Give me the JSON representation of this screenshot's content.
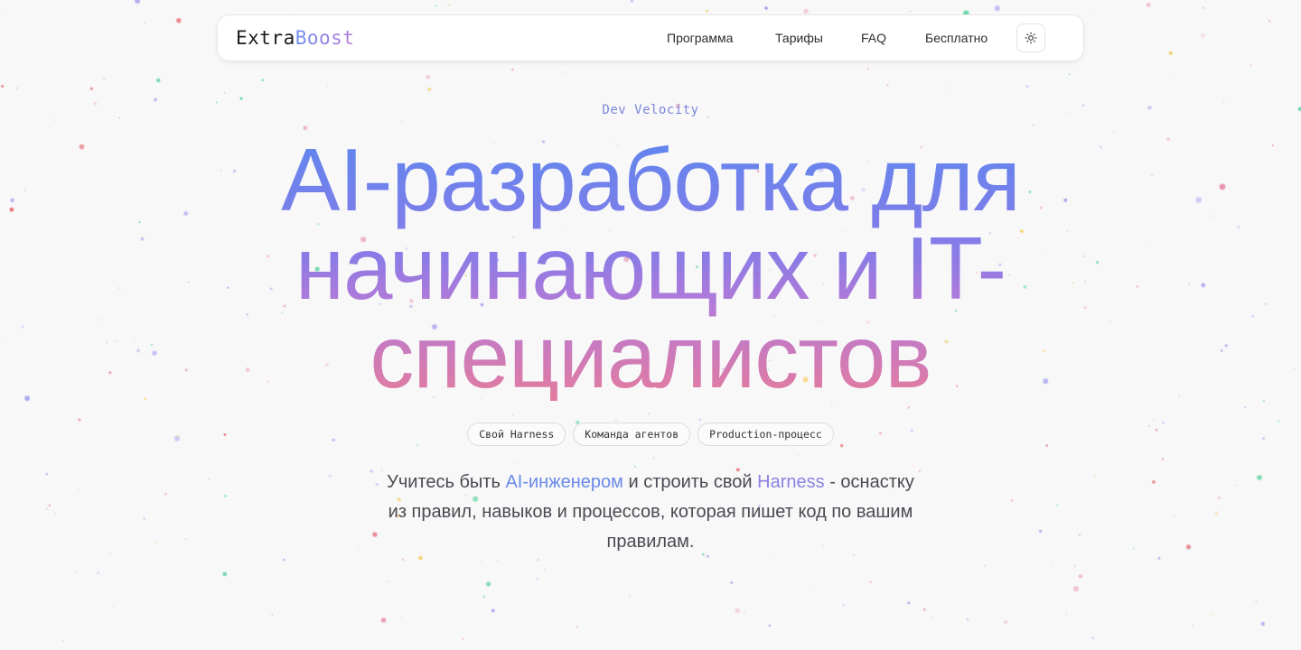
{
  "logo": {
    "part1": "Extra",
    "part2": "Boost"
  },
  "nav": {
    "items": [
      {
        "label": "Программа"
      },
      {
        "label": "Тарифы"
      },
      {
        "label": "FAQ"
      },
      {
        "label": "Бесплатно"
      }
    ],
    "theme_toggle_icon": "sun-icon"
  },
  "hero": {
    "eyebrow": "Dev Velocity",
    "title": "AI-разработка для начинающих и IT-специалистов",
    "tags": [
      "Свой Harness",
      "Команда агентов",
      "Production-процесс"
    ],
    "description": {
      "part1": "Учитесь быть ",
      "highlight1": "AI-инженером",
      "part2": " и строить свой ",
      "highlight2": "Harness",
      "part3": " - оснастку из правил, навыков и процессов, которая пишет код по вашим правилам."
    }
  },
  "colors": {
    "background": "#f8f8f9",
    "accent_blue": "#5f86ef",
    "accent_purple": "#8a7be6",
    "accent_pink": "#e47b9e"
  }
}
